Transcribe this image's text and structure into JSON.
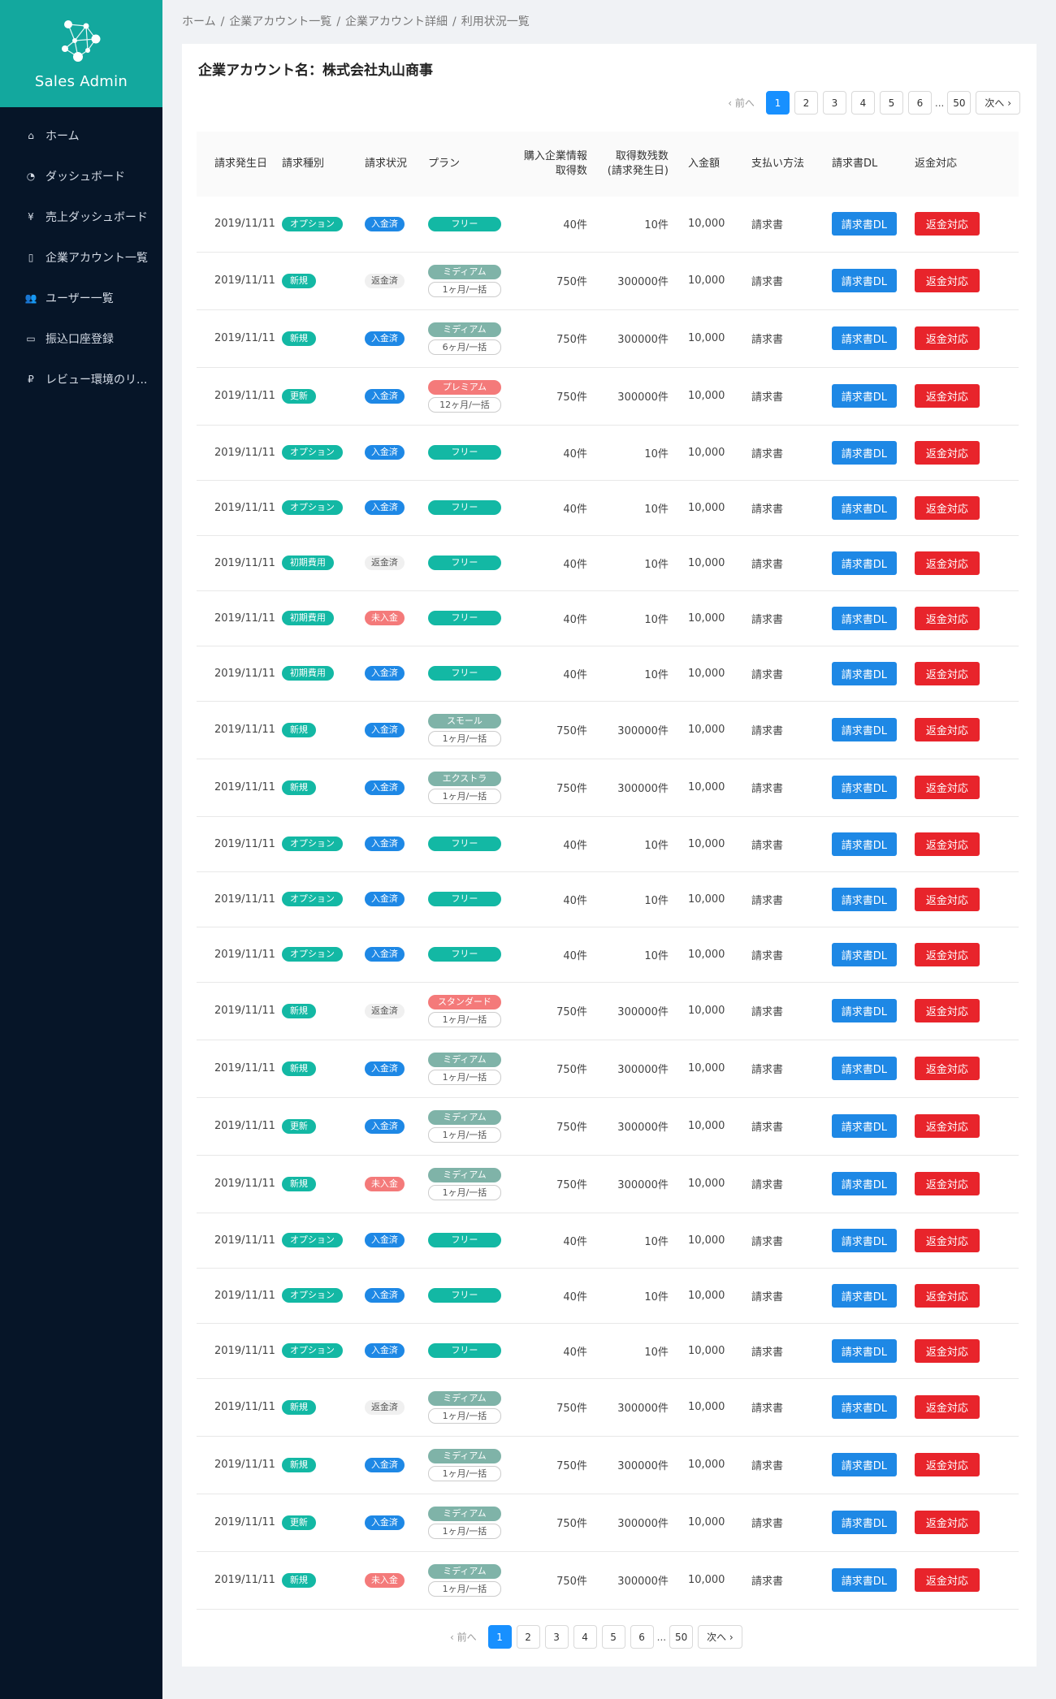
{
  "brand": {
    "title": "Sales Admin"
  },
  "nav": [
    {
      "icon": "home-icon",
      "label": "ホーム"
    },
    {
      "icon": "dashboard-icon",
      "label": "ダッシュボード"
    },
    {
      "icon": "yen-icon",
      "label": "売上ダッシュボード"
    },
    {
      "icon": "building-icon",
      "label": "企業アカウント一覧"
    },
    {
      "icon": "users-icon",
      "label": "ユーザー一覧"
    },
    {
      "icon": "credit-card-icon",
      "label": "振込口座登録"
    },
    {
      "icon": "ruble-icon",
      "label": "レビュー環境のリ..."
    }
  ],
  "breadcrumb": [
    "ホーム",
    "企業アカウント一覧",
    "企業アカウント詳細",
    "利用状況一覧"
  ],
  "page_title": "企業アカウント名：株式会社丸山商事",
  "pagination": {
    "prev": "‹ 前へ",
    "pages": [
      "1",
      "2",
      "3",
      "4",
      "5",
      "6"
    ],
    "dots": "...",
    "last": "50",
    "next": "次へ ›",
    "current": "1"
  },
  "table": {
    "headers": {
      "date": "請求発生日",
      "type": "請求種別",
      "status": "請求状況",
      "plan": "プラン",
      "purchased_1": "購入企業情報",
      "purchased_2": "取得数",
      "remaining_1": "取得数残数",
      "remaining_2": "(請求発生日)",
      "amount": "入金額",
      "method": "支払い方法",
      "dl": "請求書DL",
      "refund": "返金対応"
    },
    "rows": [
      {
        "date": "2019/11/11",
        "type": "オプション",
        "status": "入金済",
        "plan": "フリー",
        "term": "",
        "purchased": "40件",
        "remaining": "10件",
        "amount": "10,000",
        "method": "請求書"
      },
      {
        "date": "2019/11/11",
        "type": "新規",
        "status": "返金済",
        "plan": "ミディアム",
        "term": "1ヶ月/一括",
        "purchased": "750件",
        "remaining": "300000件",
        "amount": "10,000",
        "method": "請求書"
      },
      {
        "date": "2019/11/11",
        "type": "新規",
        "status": "入金済",
        "plan": "ミディアム",
        "term": "6ヶ月/一括",
        "purchased": "750件",
        "remaining": "300000件",
        "amount": "10,000",
        "method": "請求書"
      },
      {
        "date": "2019/11/11",
        "type": "更新",
        "status": "入金済",
        "plan": "プレミアム",
        "term": "12ヶ月/一括",
        "purchased": "750件",
        "remaining": "300000件",
        "amount": "10,000",
        "method": "請求書"
      },
      {
        "date": "2019/11/11",
        "type": "オプション",
        "status": "入金済",
        "plan": "フリー",
        "term": "",
        "purchased": "40件",
        "remaining": "10件",
        "amount": "10,000",
        "method": "請求書"
      },
      {
        "date": "2019/11/11",
        "type": "オプション",
        "status": "入金済",
        "plan": "フリー",
        "term": "",
        "purchased": "40件",
        "remaining": "10件",
        "amount": "10,000",
        "method": "請求書"
      },
      {
        "date": "2019/11/11",
        "type": "初期費用",
        "status": "返金済",
        "plan": "フリー",
        "term": "",
        "purchased": "40件",
        "remaining": "10件",
        "amount": "10,000",
        "method": "請求書"
      },
      {
        "date": "2019/11/11",
        "type": "初期費用",
        "status": "未入金",
        "plan": "フリー",
        "term": "",
        "purchased": "40件",
        "remaining": "10件",
        "amount": "10,000",
        "method": "請求書"
      },
      {
        "date": "2019/11/11",
        "type": "初期費用",
        "status": "入金済",
        "plan": "フリー",
        "term": "",
        "purchased": "40件",
        "remaining": "10件",
        "amount": "10,000",
        "method": "請求書"
      },
      {
        "date": "2019/11/11",
        "type": "新規",
        "status": "入金済",
        "plan": "スモール",
        "term": "1ヶ月/一括",
        "purchased": "750件",
        "remaining": "300000件",
        "amount": "10,000",
        "method": "請求書"
      },
      {
        "date": "2019/11/11",
        "type": "新規",
        "status": "入金済",
        "plan": "エクストラ",
        "term": "1ヶ月/一括",
        "purchased": "750件",
        "remaining": "300000件",
        "amount": "10,000",
        "method": "請求書"
      },
      {
        "date": "2019/11/11",
        "type": "オプション",
        "status": "入金済",
        "plan": "フリー",
        "term": "",
        "purchased": "40件",
        "remaining": "10件",
        "amount": "10,000",
        "method": "請求書"
      },
      {
        "date": "2019/11/11",
        "type": "オプション",
        "status": "入金済",
        "plan": "フリー",
        "term": "",
        "purchased": "40件",
        "remaining": "10件",
        "amount": "10,000",
        "method": "請求書"
      },
      {
        "date": "2019/11/11",
        "type": "オプション",
        "status": "入金済",
        "plan": "フリー",
        "term": "",
        "purchased": "40件",
        "remaining": "10件",
        "amount": "10,000",
        "method": "請求書"
      },
      {
        "date": "2019/11/11",
        "type": "新規",
        "status": "返金済",
        "plan": "スタンダード",
        "term": "1ヶ月/一括",
        "purchased": "750件",
        "remaining": "300000件",
        "amount": "10,000",
        "method": "請求書"
      },
      {
        "date": "2019/11/11",
        "type": "新規",
        "status": "入金済",
        "plan": "ミディアム",
        "term": "1ヶ月/一括",
        "purchased": "750件",
        "remaining": "300000件",
        "amount": "10,000",
        "method": "請求書"
      },
      {
        "date": "2019/11/11",
        "type": "更新",
        "status": "入金済",
        "plan": "ミディアム",
        "term": "1ヶ月/一括",
        "purchased": "750件",
        "remaining": "300000件",
        "amount": "10,000",
        "method": "請求書"
      },
      {
        "date": "2019/11/11",
        "type": "新規",
        "status": "未入金",
        "plan": "ミディアム",
        "term": "1ヶ月/一括",
        "purchased": "750件",
        "remaining": "300000件",
        "amount": "10,000",
        "method": "請求書"
      },
      {
        "date": "2019/11/11",
        "type": "オプション",
        "status": "入金済",
        "plan": "フリー",
        "term": "",
        "purchased": "40件",
        "remaining": "10件",
        "amount": "10,000",
        "method": "請求書"
      },
      {
        "date": "2019/11/11",
        "type": "オプション",
        "status": "入金済",
        "plan": "フリー",
        "term": "",
        "purchased": "40件",
        "remaining": "10件",
        "amount": "10,000",
        "method": "請求書"
      },
      {
        "date": "2019/11/11",
        "type": "オプション",
        "status": "入金済",
        "plan": "フリー",
        "term": "",
        "purchased": "40件",
        "remaining": "10件",
        "amount": "10,000",
        "method": "請求書"
      },
      {
        "date": "2019/11/11",
        "type": "新規",
        "status": "返金済",
        "plan": "ミディアム",
        "term": "1ヶ月/一括",
        "purchased": "750件",
        "remaining": "300000件",
        "amount": "10,000",
        "method": "請求書"
      },
      {
        "date": "2019/11/11",
        "type": "新規",
        "status": "入金済",
        "plan": "ミディアム",
        "term": "1ヶ月/一括",
        "purchased": "750件",
        "remaining": "300000件",
        "amount": "10,000",
        "method": "請求書"
      },
      {
        "date": "2019/11/11",
        "type": "更新",
        "status": "入金済",
        "plan": "ミディアム",
        "term": "1ヶ月/一括",
        "purchased": "750件",
        "remaining": "300000件",
        "amount": "10,000",
        "method": "請求書"
      },
      {
        "date": "2019/11/11",
        "type": "新規",
        "status": "未入金",
        "plan": "ミディアム",
        "term": "1ヶ月/一括",
        "purchased": "750件",
        "remaining": "300000件",
        "amount": "10,000",
        "method": "請求書"
      }
    ],
    "dl_label": "請求書DL",
    "refund_label": "返金対応"
  },
  "colors": {
    "brand": "#13a89e",
    "sidebar": "#061528",
    "primary": "#1890ff",
    "danger": "#e8242b",
    "teal_badge": "#13b8a4",
    "muted_badge": "#7fb3a8",
    "pink_badge": "#f47a7a"
  }
}
